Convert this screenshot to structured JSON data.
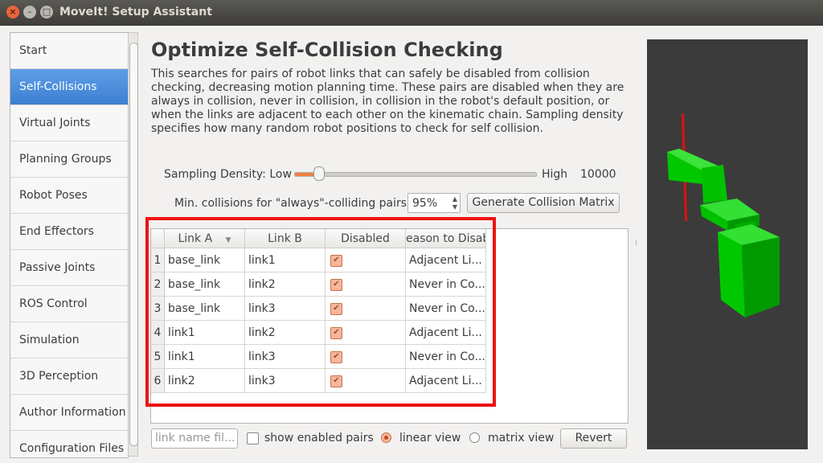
{
  "window": {
    "title": "MoveIt! Setup Assistant"
  },
  "sidebar": {
    "items": [
      {
        "label": "Start",
        "active": false
      },
      {
        "label": "Self-Collisions",
        "active": true
      },
      {
        "label": "Virtual Joints",
        "active": false
      },
      {
        "label": "Planning Groups",
        "active": false
      },
      {
        "label": "Robot Poses",
        "active": false
      },
      {
        "label": "End Effectors",
        "active": false
      },
      {
        "label": "Passive Joints",
        "active": false
      },
      {
        "label": "ROS Control",
        "active": false
      },
      {
        "label": "Simulation",
        "active": false
      },
      {
        "label": "3D Perception",
        "active": false
      },
      {
        "label": "Author Information",
        "active": false
      },
      {
        "label": "Configuration Files",
        "active": false
      }
    ]
  },
  "main": {
    "title": "Optimize Self-Collision Checking",
    "description": "This searches for pairs of robot links that can safely be disabled from collision checking, decreasing motion planning time. These pairs are disabled when they are always in collision, never in collision, in collision in the robot's default position, or when the links are adjacent to each other on the kinematic chain. Sampling density specifies how many random robot positions to check for self collision.",
    "sampling": {
      "label": "Sampling Density: Low",
      "high_label": "High",
      "value": "10000",
      "fraction": 0.1
    },
    "min_collisions": {
      "label": "Min. collisions for \"always\"-colliding pairs:",
      "value": "95%"
    },
    "generate_label": "Generate Collision Matrix",
    "table": {
      "headers": [
        "Link A",
        "Link B",
        "Disabled",
        "eason to Disab"
      ],
      "rows": [
        {
          "num": "1",
          "a": "base_link",
          "b": "link1",
          "disabled": true,
          "reason": "Adjacent Li..."
        },
        {
          "num": "2",
          "a": "base_link",
          "b": "link2",
          "disabled": true,
          "reason": "Never in Co..."
        },
        {
          "num": "3",
          "a": "base_link",
          "b": "link3",
          "disabled": true,
          "reason": "Never in Co..."
        },
        {
          "num": "4",
          "a": "link1",
          "b": "link2",
          "disabled": true,
          "reason": "Adjacent Li..."
        },
        {
          "num": "5",
          "a": "link1",
          "b": "link3",
          "disabled": true,
          "reason": "Never in Co..."
        },
        {
          "num": "6",
          "a": "link2",
          "b": "link3",
          "disabled": true,
          "reason": "Adjacent Li..."
        }
      ]
    },
    "footer": {
      "filter_placeholder": "link name fil...",
      "show_enabled_label": "show enabled pairs",
      "linear_view_label": "linear view",
      "matrix_view_label": "matrix view",
      "view_mode": "linear",
      "revert_label": "Revert"
    }
  },
  "colors": {
    "accent": "#f08040",
    "selection": "#3d7fd0",
    "highlight_box": "#ee1111",
    "robot": "#00cc00",
    "viewer_bg": "#3b3b3b"
  }
}
